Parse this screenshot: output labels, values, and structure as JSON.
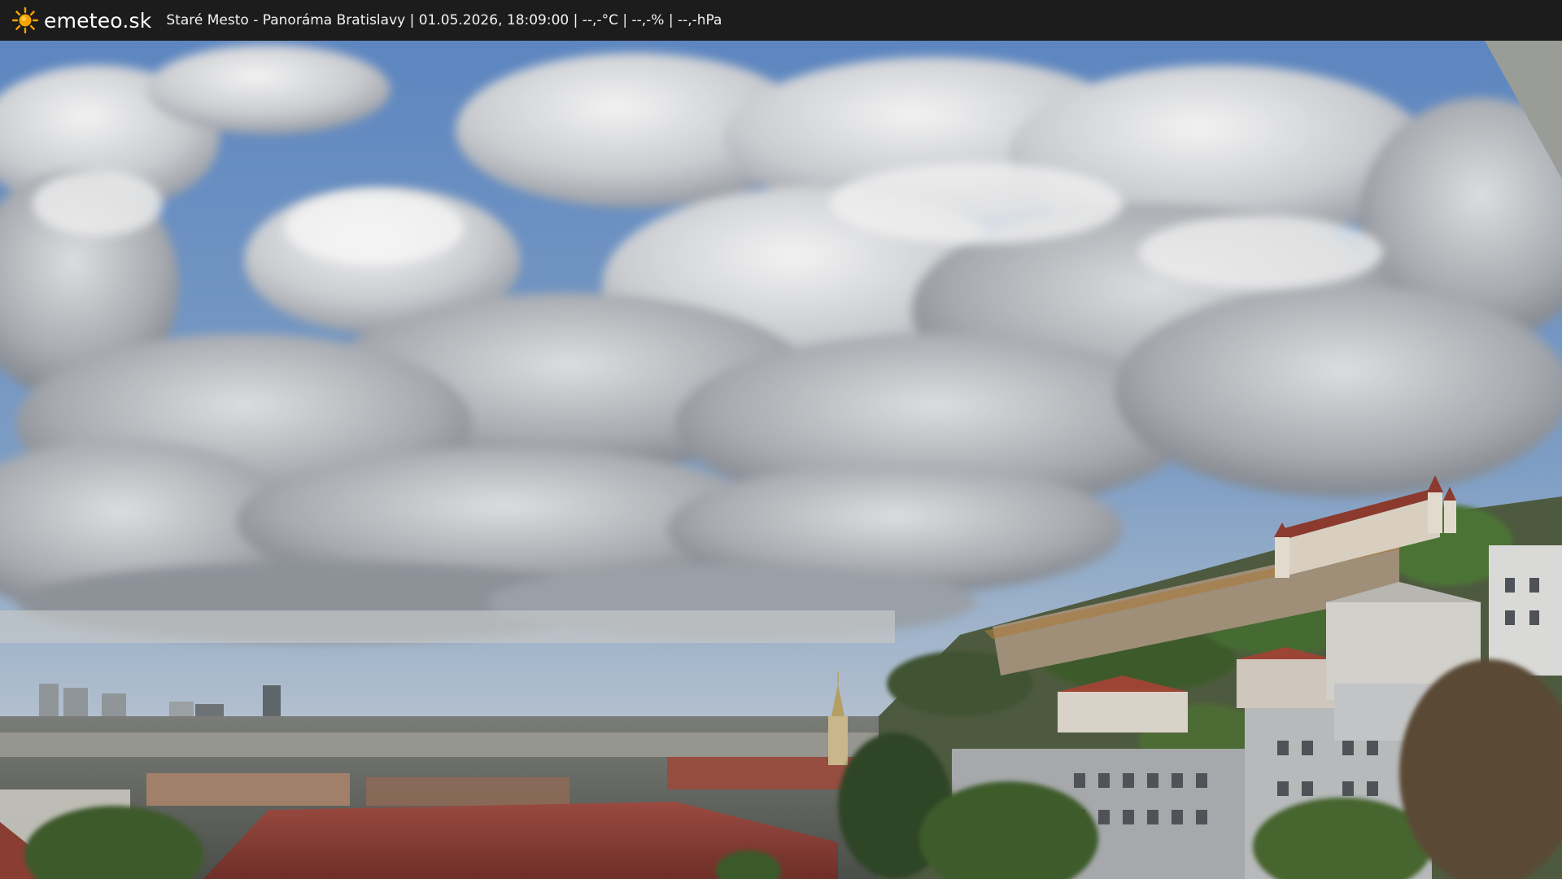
{
  "header": {
    "brand": "emeteo.sk",
    "caption": "Staré Mesto - Panoráma Bratislavy | 01.05.2026, 18:09:00 | --,-°C | --,-% | --,-hPa",
    "logo_icon": "sun-icon",
    "logo_color": "#f5a300"
  },
  "scene": {
    "sky_color": "#6f93c2",
    "cloud_color": "#e3e4e6",
    "roof_color": "#8a3d33"
  }
}
